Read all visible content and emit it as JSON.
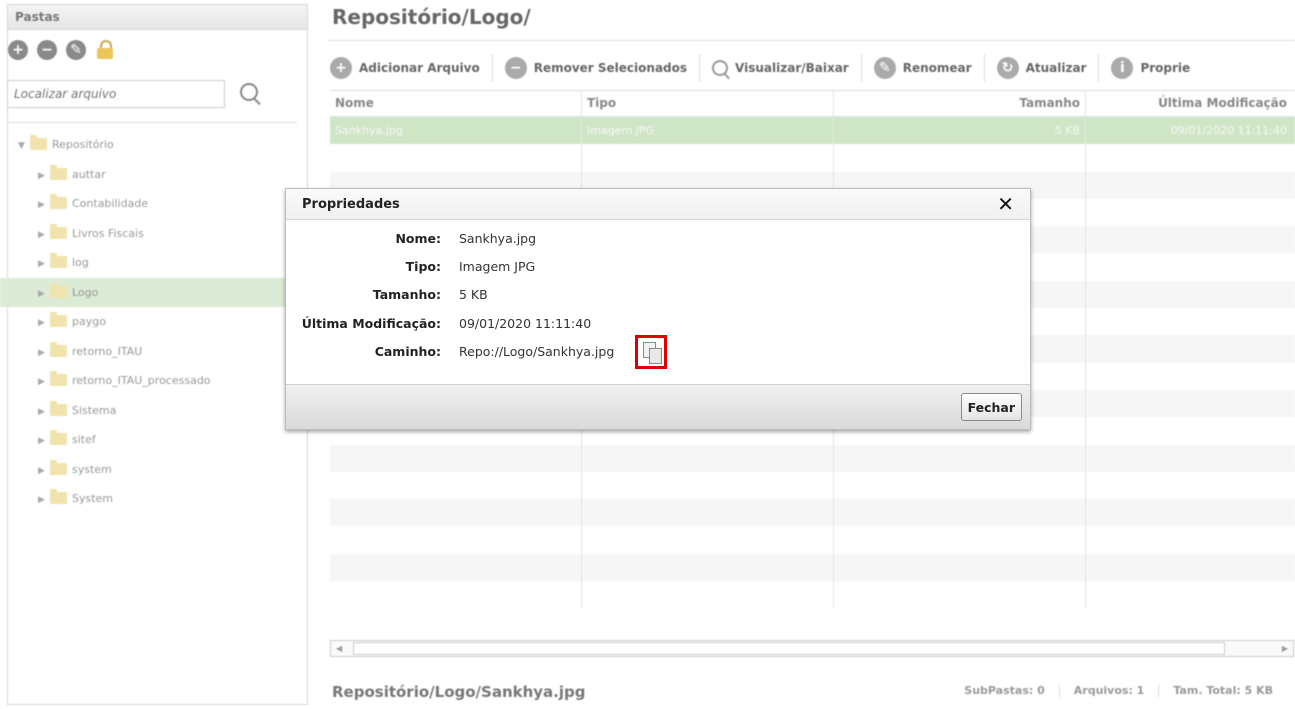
{
  "left_panel": {
    "header": "Pastas",
    "toolbar_icons": [
      "add-folder-icon",
      "remove-folder-icon",
      "edit-folder-icon",
      "lock-icon"
    ],
    "search_placeholder": "Localizar arquivo",
    "tree": {
      "root": "Repositório",
      "children": [
        "auttar",
        "Contabilidade",
        "Livros Fiscais",
        "log",
        "Logo",
        "paygo",
        "retorno_ITAU",
        "retorno_ITAU_processado",
        "Sistema",
        "sitef",
        "system",
        "System"
      ],
      "selected": "Logo"
    }
  },
  "main": {
    "title": "Repositório/Logo/",
    "toolbar": {
      "add": "Adicionar Arquivo",
      "remove": "Remover Selecionados",
      "view": "Visualizar/Baixar",
      "rename": "Renomear",
      "refresh": "Atualizar",
      "properties": "Proprie"
    },
    "grid": {
      "columns": [
        "Nome",
        "Tipo",
        "Tamanho",
        "Última Modificação"
      ],
      "rows": [
        [
          "Sankhya.jpg",
          "Imagem JPG",
          "5 KB",
          "09/01/2020 11:11:40"
        ]
      ]
    },
    "status": {
      "path": "Repositório/Logo/Sankhya.jpg",
      "subfolders": "SubPastas: 0",
      "files": "Arquivos: 1",
      "total": "Tam. Total: 5 KB"
    }
  },
  "modal": {
    "title": "Propriedades",
    "close": "✕",
    "labels": {
      "name": "Nome:",
      "type": "Tipo:",
      "size": "Tamanho:",
      "modified": "Última Modificação:",
      "path": "Caminho:"
    },
    "values": {
      "name": "Sankhya.jpg",
      "type": "Imagem JPG",
      "size": "5 KB",
      "modified": "09/01/2020 11:11:40",
      "path": "Repo://Logo/Sankhya.jpg"
    },
    "close_button": "Fechar"
  }
}
